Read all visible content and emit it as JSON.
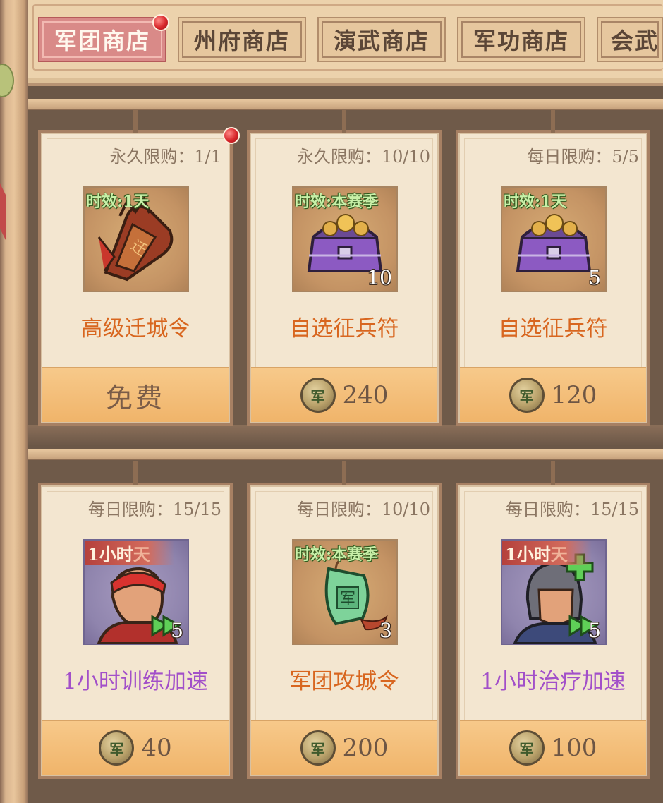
{
  "tabs": [
    {
      "label": "军团商店",
      "active": true,
      "has_dot": true
    },
    {
      "label": "州府商店",
      "active": false
    },
    {
      "label": "演武商店",
      "active": false
    },
    {
      "label": "军功商店",
      "active": false
    },
    {
      "label": "会武",
      "active": false
    }
  ],
  "items": [
    {
      "limit": "永久限购：1/1",
      "badge": "时效:1天",
      "badge_style": "green",
      "qty": "",
      "name": "高级迁城令",
      "name_color": "orange",
      "price": "免费",
      "free": true,
      "has_dot": true,
      "icon": "migration-token-icon"
    },
    {
      "limit": "永久限购：10/10",
      "badge": "时效:本赛季",
      "badge_style": "green",
      "qty": "10",
      "name": "自选征兵符",
      "name_color": "orange",
      "price": "240",
      "free": false,
      "icon": "treasure-chest-icon"
    },
    {
      "limit": "每日限购：5/5",
      "badge": "时效:1天",
      "badge_style": "green",
      "qty": "5",
      "name": "自选征兵符",
      "name_color": "orange",
      "price": "120",
      "free": false,
      "icon": "treasure-chest-icon"
    },
    {
      "limit": "每日限购：15/15",
      "badge": "1小时",
      "badge_tail": "天",
      "badge_style": "red",
      "qty": "5",
      "name": "1小时训练加速",
      "name_color": "purple",
      "price": "40",
      "free": false,
      "icon": "soldier-headband-icon"
    },
    {
      "limit": "每日限购：10/10",
      "badge": "时效:本赛季",
      "badge_style": "green",
      "qty": "3",
      "name": "军团攻城令",
      "name_color": "orange",
      "price": "200",
      "free": false,
      "icon": "jade-token-icon"
    },
    {
      "limit": "每日限购：15/15",
      "badge": "1小时",
      "badge_tail": "天",
      "badge_style": "red",
      "qty": "5",
      "name": "1小时治疗加速",
      "name_color": "purple",
      "price": "100",
      "free": false,
      "icon": "soldier-helmet-icon"
    }
  ],
  "currency": {
    "coin_glyph": "军"
  },
  "colors": {
    "name_orange": "#d8661f",
    "name_purple": "#a24fc9",
    "tab_active": "#d98a88"
  }
}
